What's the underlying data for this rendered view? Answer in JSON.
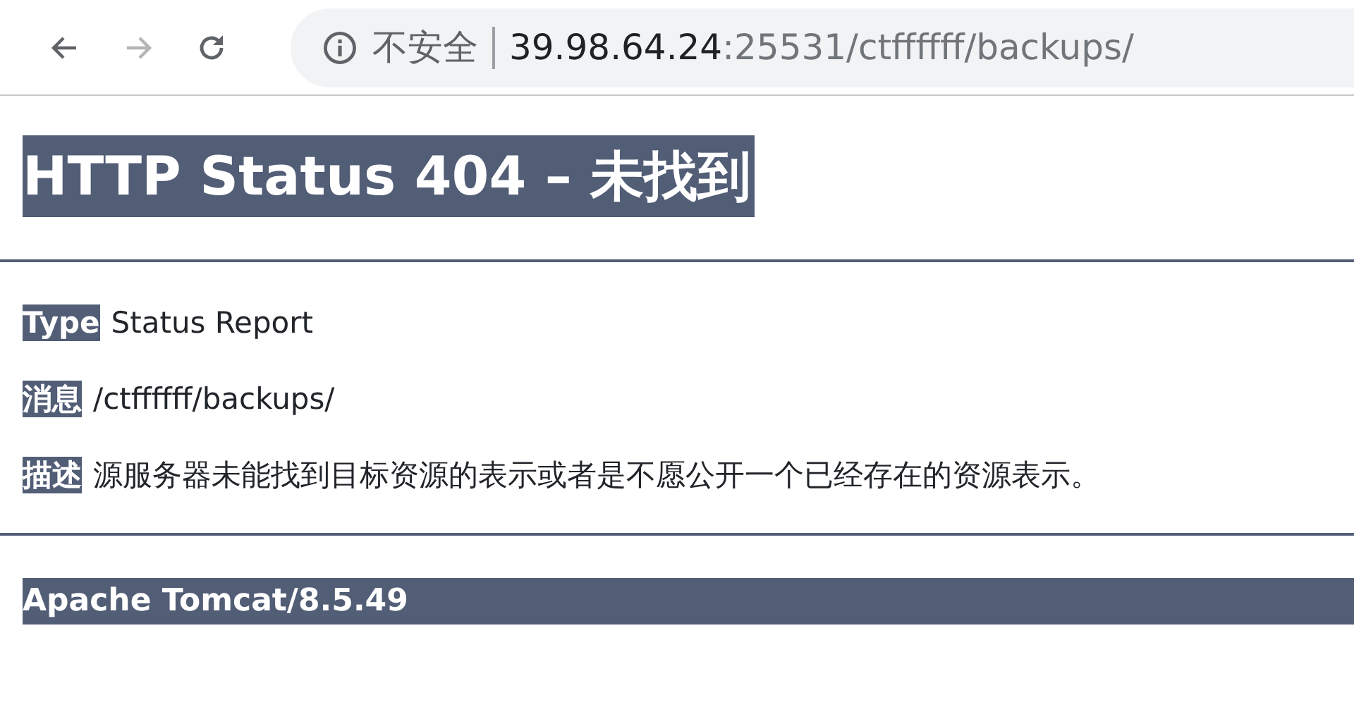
{
  "browser": {
    "back": {
      "disabled": false
    },
    "forward": {
      "disabled": true
    },
    "address_bar": {
      "security_label": "不安全",
      "host": "39.98.64.24",
      "path": ":25531/ctffffff/backups/"
    }
  },
  "page": {
    "title": "HTTP Status 404 – 未找到",
    "fields": [
      {
        "label": "Type",
        "value": "Status Report"
      },
      {
        "label": "消息",
        "value": "/ctffffff/backups/"
      },
      {
        "label": "描述",
        "value": "源服务器未能找到目标资源的表示或者是不愿公开一个已经存在的资源表示。"
      }
    ],
    "footer": "Apache Tomcat/8.5.49"
  }
}
